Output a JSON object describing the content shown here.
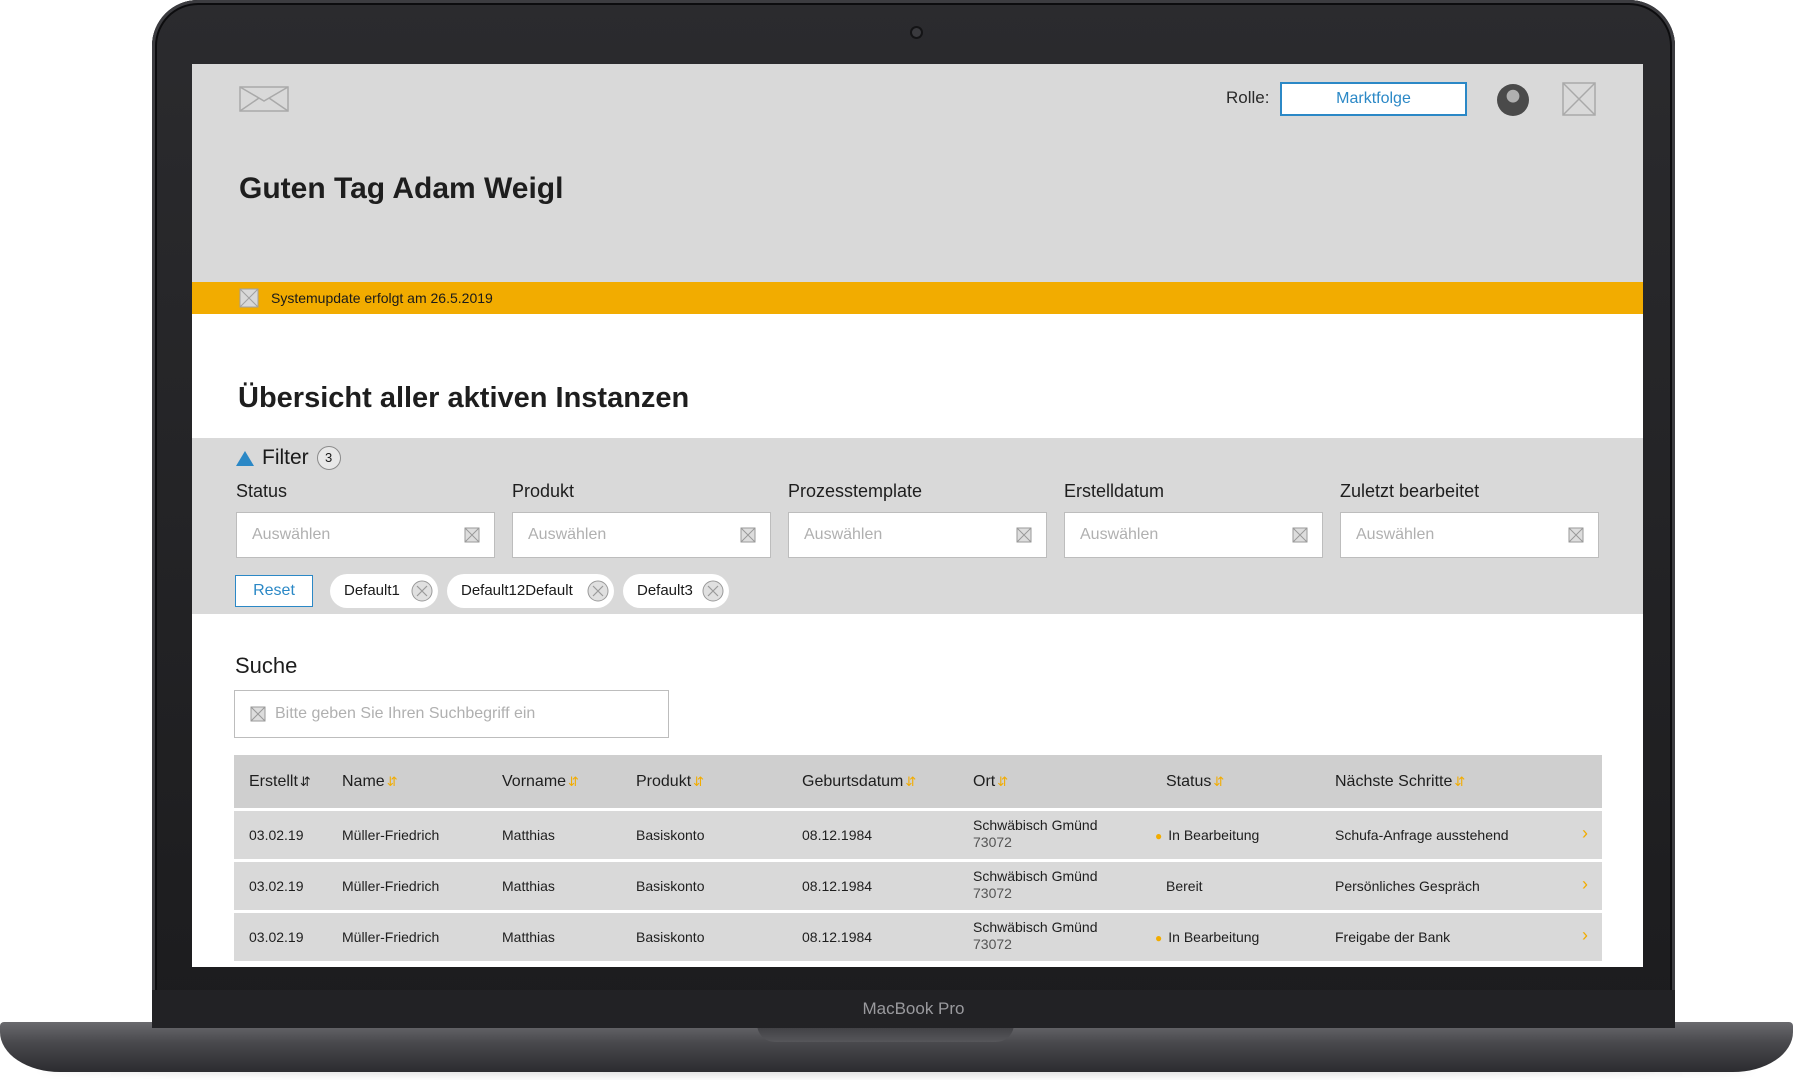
{
  "device": {
    "label": "MacBook Pro"
  },
  "header": {
    "role_label": "Rolle:",
    "role_value": "Marktfolge",
    "greeting": "Guten Tag Adam Weigl"
  },
  "notice": {
    "text": "Systemupdate erfolgt am 26.5.2019"
  },
  "overview": {
    "title": "Übersicht aller aktiven Instanzen"
  },
  "filter": {
    "toggle_label": "Filter",
    "count": "3",
    "fields": [
      {
        "label": "Status",
        "placeholder": "Auswählen"
      },
      {
        "label": "Produkt",
        "placeholder": "Auswählen"
      },
      {
        "label": "Prozesstemplate",
        "placeholder": "Auswählen"
      },
      {
        "label": "Erstelldatum",
        "placeholder": "Auswählen"
      },
      {
        "label": "Zuletzt bearbeitet",
        "placeholder": "Auswählen"
      }
    ],
    "reset_label": "Reset",
    "chips": [
      "Default1",
      "Default12Default",
      "Default3"
    ]
  },
  "search": {
    "label": "Suche",
    "placeholder": "Bitte geben Sie Ihren Suchbegriff ein"
  },
  "table": {
    "columns": [
      "Erstellt",
      "Name",
      "Vorname",
      "Produkt",
      "Geburtsdatum",
      "Ort",
      "Status",
      "Nächste Schritte"
    ],
    "rows": [
      {
        "erstellt": "03.02.19",
        "name": "Müller-Friedrich",
        "vorname": "Matthias",
        "produkt": "Basiskonto",
        "geburtsdatum": "08.12.1984",
        "ort": "Schwäbisch Gmünd",
        "plz": "73072",
        "status": "In Bearbeitung",
        "naechste": "Schufa-Anfrage ausstehend"
      },
      {
        "erstellt": "03.02.19",
        "name": "Müller-Friedrich",
        "vorname": "Matthias",
        "produkt": "Basiskonto",
        "geburtsdatum": "08.12.1984",
        "ort": "Schwäbisch Gmünd",
        "plz": "73072",
        "status": "Bereit",
        "naechste": "Persönliches Gespräch"
      },
      {
        "erstellt": "03.02.19",
        "name": "Müller-Friedrich",
        "vorname": "Matthias",
        "produkt": "Basiskonto",
        "geburtsdatum": "08.12.1984",
        "ort": "Schwäbisch Gmünd",
        "plz": "73072",
        "status": "In Bearbeitung",
        "naechste": "Freigabe der Bank"
      }
    ]
  },
  "colors": {
    "accent_blue": "#2b88c6",
    "accent_yellow": "#f2ac00",
    "panel_gray": "#d9d9d9"
  },
  "icons": {
    "logo": "mail-placeholder-icon",
    "close": "close-placeholder-icon",
    "filter_toggle": "triangle-up-icon",
    "chip_remove": "clear-icon",
    "sort": "sort-arrows-icon",
    "row_action": "chevron-right-icon"
  }
}
